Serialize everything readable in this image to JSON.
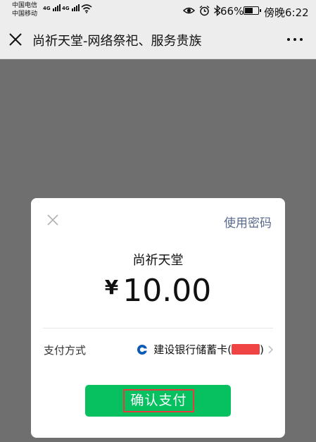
{
  "status_bar": {
    "carrier_1": "中国电信",
    "carrier_2": "中国移动",
    "signal_1_tech": "4G",
    "signal_2_tech": "4G",
    "battery_percent": "66%",
    "time": "傍晚6:22",
    "icons": [
      "eye-icon",
      "alarm-icon",
      "bluetooth-icon",
      "battery-icon",
      "wifi-icon"
    ]
  },
  "nav": {
    "title": "尚祈天堂-网络祭祀、服务贵族",
    "icons": [
      "close-icon",
      "more-icon"
    ]
  },
  "payment_dialog": {
    "use_password": "使用密码",
    "merchant": "尚祈天堂",
    "currency": "¥",
    "amount": "10.00",
    "pay_method_label": "支付方式",
    "pay_method_value": "建设银行储蓄卡(",
    "pay_method_suffix": ")",
    "confirm_button": "确认支付",
    "colors": {
      "confirm_green": "#07c160",
      "link_blue_gray": "#5a6b8e",
      "highlight_red": "#e63b3b",
      "redaction_red": "#f04444"
    }
  }
}
